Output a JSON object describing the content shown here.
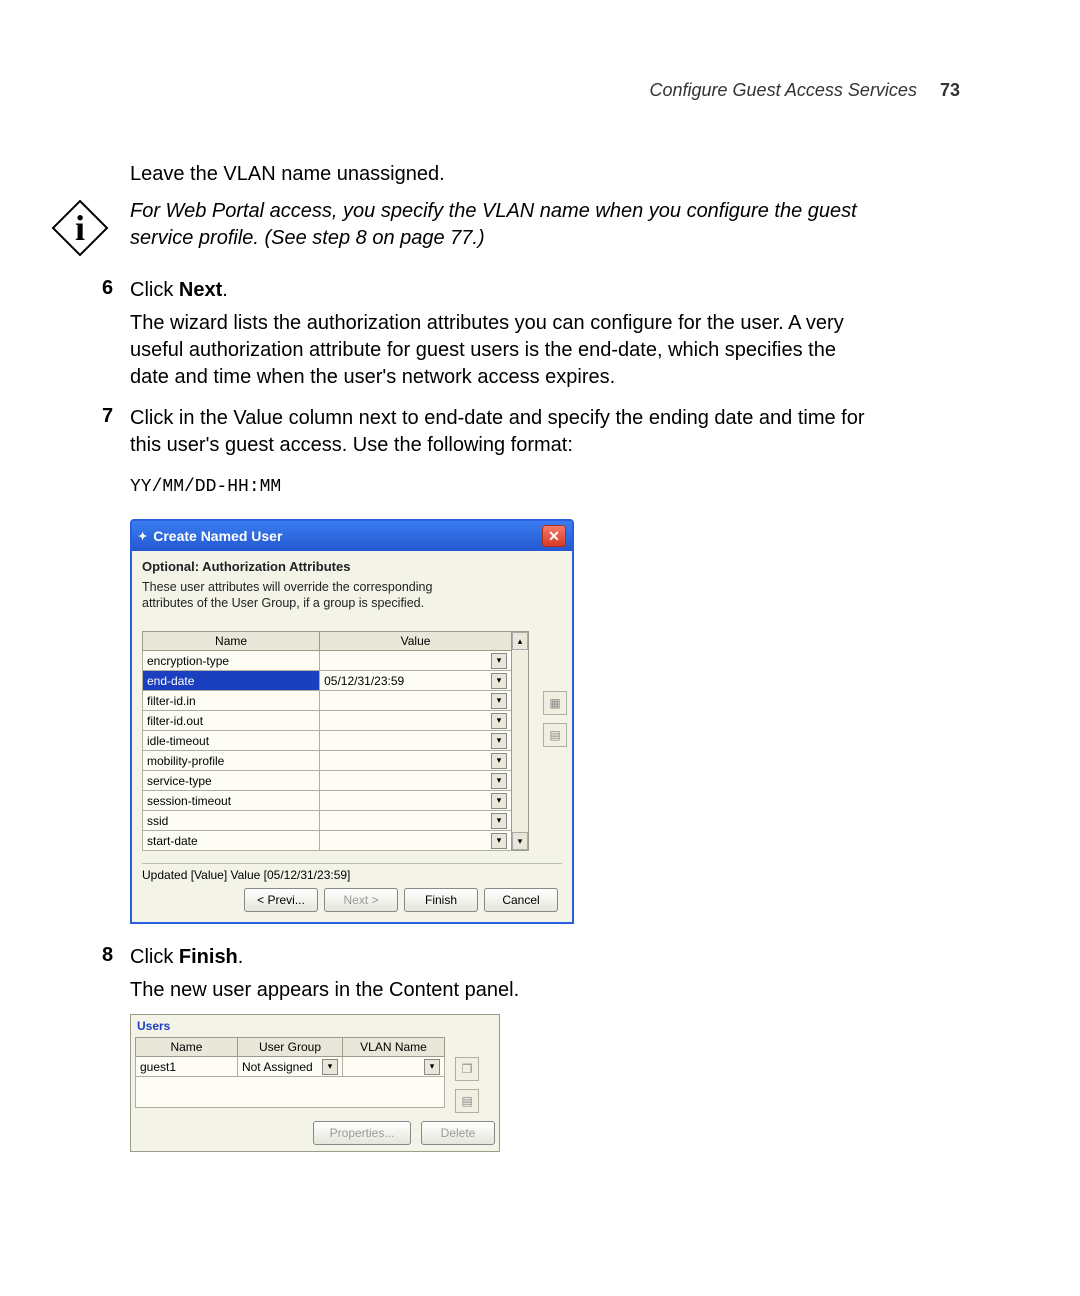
{
  "header": {
    "section": "Configure Guest Access Services",
    "page": "73"
  },
  "text": {
    "leave_vlan": "Leave the VLAN name unassigned.",
    "note": "For Web Portal access, you specify the VLAN name when you configure the guest service profile. (See step 8 on page 77.)",
    "step6_num": "6",
    "step6_label_pre": "Click ",
    "step6_bold": "Next",
    "step6_label_post": ".",
    "step6_follow": "The wizard lists the authorization attributes you can configure for the user. A very useful authorization attribute for guest users is the end-date, which specifies the date and time when the user's network access expires.",
    "step7_num": "7",
    "step7_body": "Click in the Value column next to end-date and specify the ending date and time for this user's guest access. Use the following format:",
    "format": "YY/MM/DD-HH:MM",
    "step8_num": "8",
    "step8_label_pre": "Click ",
    "step8_bold": "Finish",
    "step8_label_post": ".",
    "step8_follow": "The new user appears in the Content panel."
  },
  "dialog": {
    "title": "Create Named User",
    "section": "Optional: Authorization Attributes",
    "desc": "These user attributes will override the corresponding attributes of the User Group, if a group is specified.",
    "columns": {
      "name": "Name",
      "value": "Value"
    },
    "rows": [
      {
        "name": "encryption-type",
        "value": ""
      },
      {
        "name": "end-date",
        "value": "05/12/31/23:59",
        "selected": true
      },
      {
        "name": "filter-id.in",
        "value": ""
      },
      {
        "name": "filter-id.out",
        "value": ""
      },
      {
        "name": "idle-timeout",
        "value": ""
      },
      {
        "name": "mobility-profile",
        "value": ""
      },
      {
        "name": "service-type",
        "value": ""
      },
      {
        "name": "session-timeout",
        "value": ""
      },
      {
        "name": "ssid",
        "value": ""
      },
      {
        "name": "start-date",
        "value": ""
      }
    ],
    "status": "Updated [Value] Value [05/12/31/23:59]",
    "buttons": {
      "prev": "< Previ...",
      "next": "Next >",
      "finish": "Finish",
      "cancel": "Cancel"
    }
  },
  "users_panel": {
    "title": "Users",
    "columns": {
      "name": "Name",
      "group": "User Group",
      "vlan": "VLAN Name"
    },
    "rows": [
      {
        "name": "guest1",
        "group": "Not Assigned",
        "vlan": ""
      }
    ],
    "buttons": {
      "properties": "Properties...",
      "delete": "Delete"
    }
  }
}
